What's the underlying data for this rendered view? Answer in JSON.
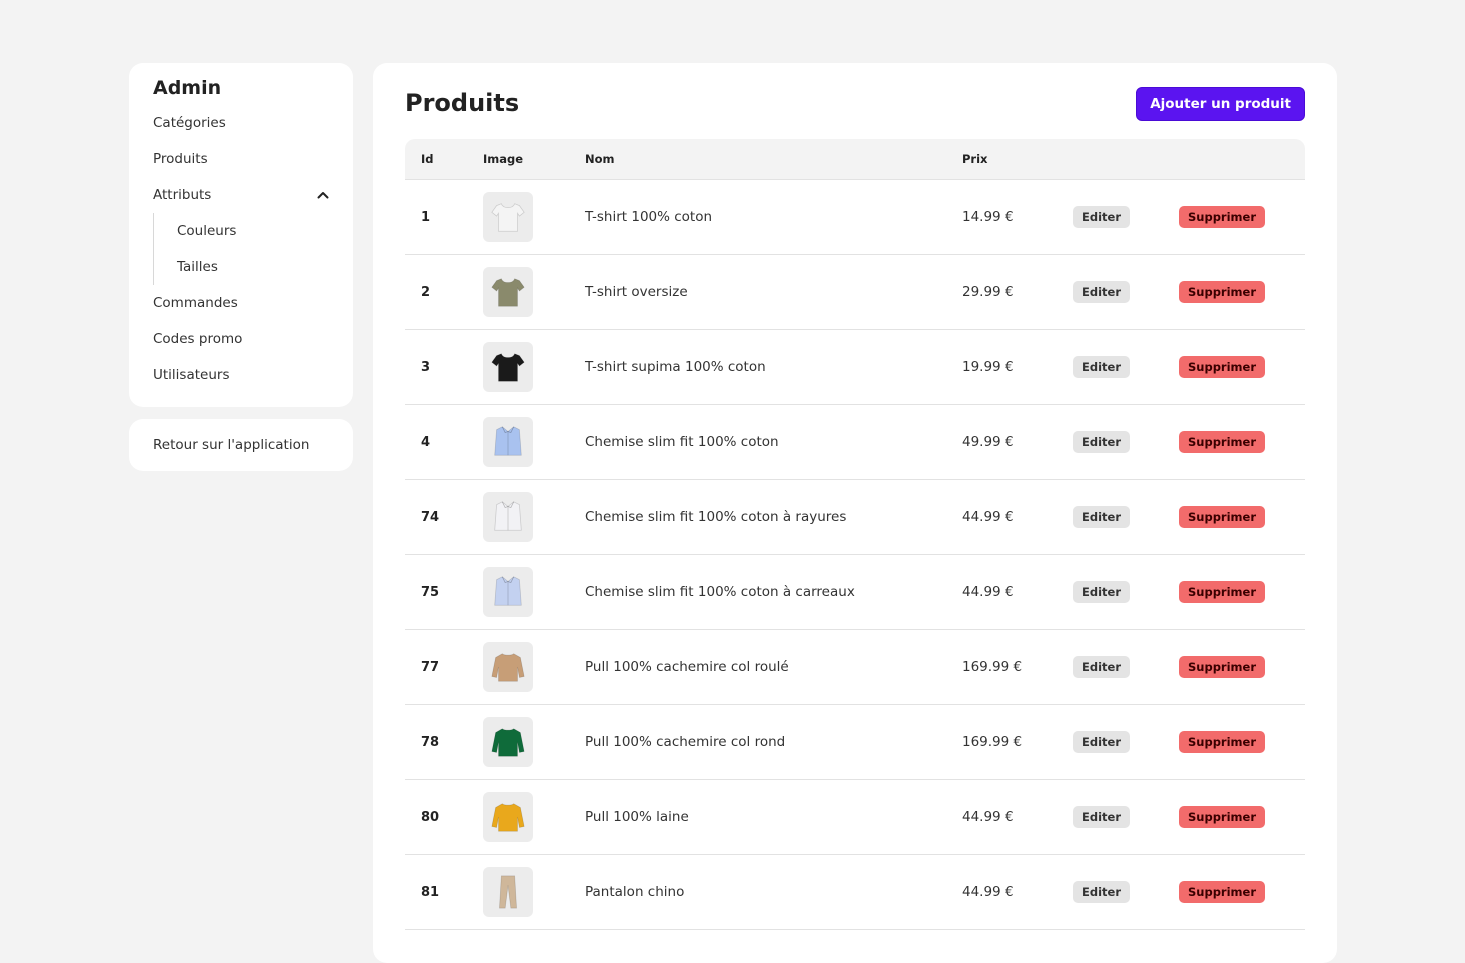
{
  "sidebar": {
    "title": "Admin",
    "items": [
      {
        "label": "Catégories"
      },
      {
        "label": "Produits"
      },
      {
        "label": "Attributs"
      }
    ],
    "sub_items": [
      {
        "label": "Couleurs"
      },
      {
        "label": "Tailles"
      }
    ],
    "items_after": [
      {
        "label": "Commandes"
      },
      {
        "label": "Codes promo"
      },
      {
        "label": "Utilisateurs"
      }
    ],
    "back_label": "Retour sur l'application"
  },
  "main": {
    "title": "Produits",
    "add_button": "Ajouter un produit",
    "headers": {
      "id": "Id",
      "image": "Image",
      "name": "Nom",
      "price": "Prix"
    },
    "edit_label": "Editer",
    "delete_label": "Supprimer",
    "rows": [
      {
        "id": "1",
        "name": "T-shirt 100% coton",
        "price": "14.99 €",
        "icon": "tshirt-icon",
        "color": "#f4f4f4"
      },
      {
        "id": "2",
        "name": "T-shirt oversize",
        "price": "29.99 €",
        "icon": "tshirt-icon",
        "color": "#8a8a6c"
      },
      {
        "id": "3",
        "name": "T-shirt supima 100% coton",
        "price": "19.99 €",
        "icon": "tshirt-icon",
        "color": "#1a1a1a"
      },
      {
        "id": "4",
        "name": "Chemise slim fit 100% coton",
        "price": "49.99 €",
        "icon": "shirt-icon",
        "color": "#a9c2ef"
      },
      {
        "id": "74",
        "name": "Chemise slim fit 100% coton à rayures",
        "price": "44.99 €",
        "icon": "shirt-icon",
        "color": "#f2f2f5"
      },
      {
        "id": "75",
        "name": "Chemise slim fit 100% coton à carreaux",
        "price": "44.99 €",
        "icon": "shirt-icon",
        "color": "#c3d1f0"
      },
      {
        "id": "77",
        "name": "Pull 100% cachemire col roulé",
        "price": "169.99 €",
        "icon": "sweater-icon",
        "color": "#c79e77"
      },
      {
        "id": "78",
        "name": "Pull 100% cachemire col rond",
        "price": "169.99 €",
        "icon": "sweater-icon",
        "color": "#0f6b3a"
      },
      {
        "id": "80",
        "name": "Pull 100% laine",
        "price": "44.99 €",
        "icon": "sweater-icon",
        "color": "#e9a81c"
      },
      {
        "id": "81",
        "name": "Pantalon chino",
        "price": "44.99 €",
        "icon": "pants-icon",
        "color": "#cfb79a"
      }
    ]
  }
}
